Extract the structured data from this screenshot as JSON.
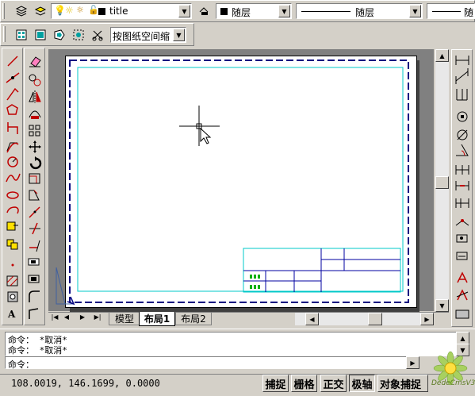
{
  "toolbar": {
    "layer_name": "title",
    "color_value": "随层",
    "linetype_value": "随层",
    "lineweight_value": "随",
    "viewport_scale": "按图纸空间缩"
  },
  "tabs": [
    {
      "label": "模型"
    },
    {
      "label": "布局1"
    },
    {
      "label": "布局2"
    }
  ],
  "command": {
    "history": [
      "命令： *取消*",
      "命令： *取消*"
    ],
    "prompt": "命令："
  },
  "status": {
    "coordinates": "108.0019, 146.1699, 0.0000",
    "buttons": [
      "捕捉",
      "栅格",
      "正交",
      "极轴",
      "对象捕捉"
    ],
    "active": [
      "极轴"
    ]
  },
  "watermark": "DedeCmsV3",
  "colors": {
    "background": "#d4d0c8",
    "canvas": "#ffffff",
    "paper_bg": "#808080",
    "margin_line": "#00c8c8",
    "titleblock": "#0000a0",
    "border_dash": "#000080"
  }
}
